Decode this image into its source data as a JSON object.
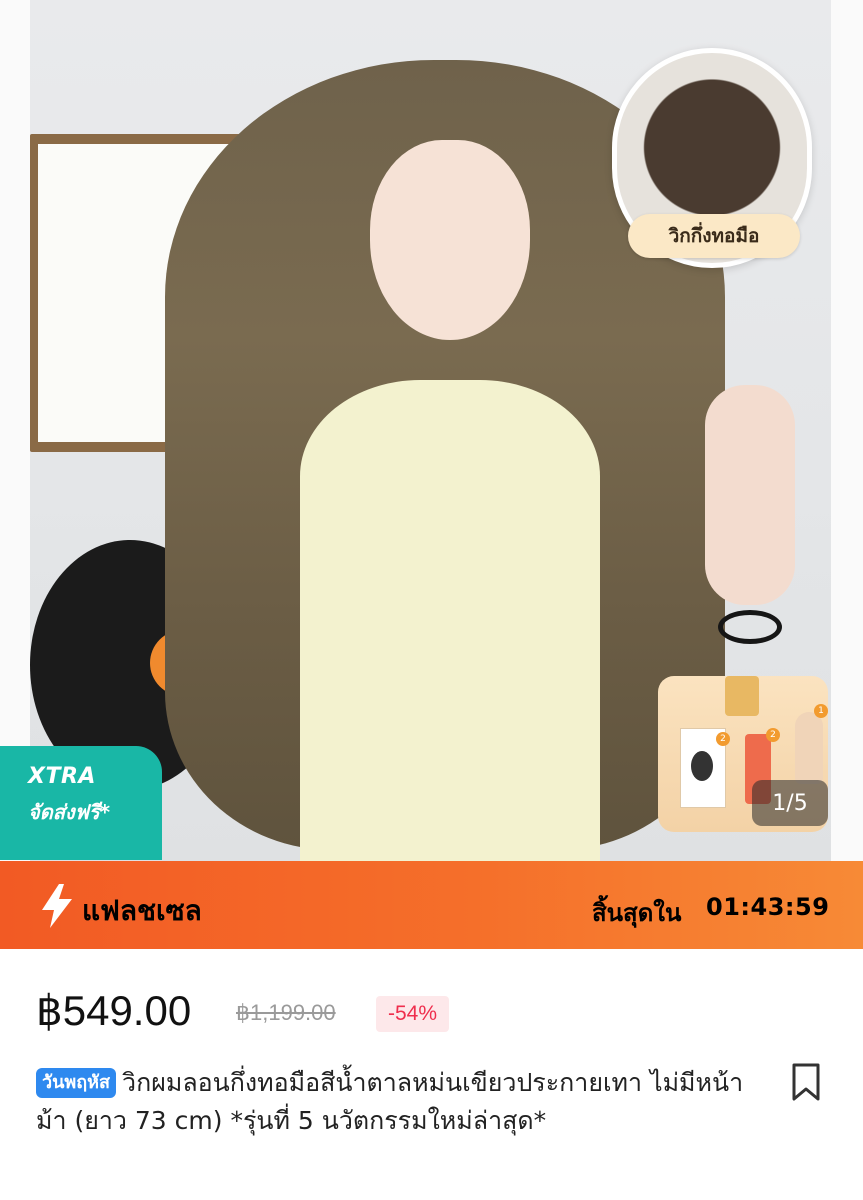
{
  "hero": {
    "inset_label": "วิกกึ่งทอมือ",
    "image_counter": "1/5",
    "gift_badges": [
      "2",
      "2",
      "1"
    ]
  },
  "badge": {
    "title": "XTRA",
    "subtitle": "จัดส่งฟรี*"
  },
  "flash_sale": {
    "label": "แฟลชเซล",
    "ends_label": "สิ้นสุดใน",
    "countdown": "01:43:59",
    "icon": "lightning-bolt-icon"
  },
  "price": {
    "current": "฿549.00",
    "original": "฿1,199.00",
    "discount": "-54%"
  },
  "product": {
    "day_tag": "วันพฤหัส",
    "title": "วิกผมลอนกึ่งทอมือสีน้ำตาลหม่นเขียวประกายเทา ไม่มีหน้าม้า (ยาว 73 cm) *รุ่นที่ 5 นวัตกรรมใหม่ล่าสุด*",
    "bookmark_icon": "bookmark-icon"
  },
  "colors": {
    "flash_bar": "#f25a24",
    "xtra_badge": "#19b7a6",
    "discount_text": "#ef2e4d",
    "day_tag": "#2e89ef"
  }
}
